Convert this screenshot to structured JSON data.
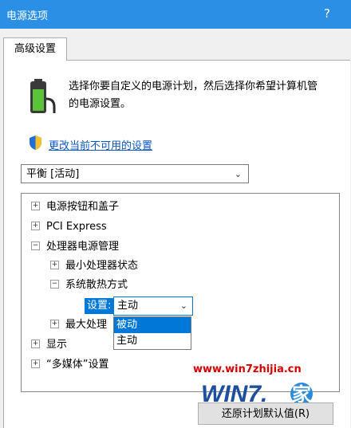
{
  "window": {
    "title": "电源选项",
    "help_label": "?"
  },
  "tab": {
    "label": "高级设置"
  },
  "description": {
    "line1": "选择你要自定义的电源计划，然后选择你希望计算机管",
    "line2": "的电源设置。"
  },
  "link": {
    "label": "更改当前不可用的设置"
  },
  "plan_select": {
    "value": "平衡 [活动]"
  },
  "tree": {
    "items": [
      {
        "label": "电源按钮和盖子",
        "expander": "+"
      },
      {
        "label": "PCI Express",
        "expander": "+"
      },
      {
        "label": "处理器电源管理",
        "expander": "−"
      },
      {
        "label": "最小处理器状态",
        "expander": "+"
      },
      {
        "label": "系统散热方式",
        "expander": "−"
      },
      {
        "label": "最大处理",
        "expander": "+"
      },
      {
        "label": "显示",
        "expander": "+"
      },
      {
        "label": "“多媒体”设置",
        "expander": "+"
      }
    ]
  },
  "setting": {
    "label": "设置:",
    "value": "主动",
    "options": [
      "被动",
      "主动"
    ],
    "highlighted_option": "被动"
  },
  "watermark": {
    "url": "www.win7zhijia.cn",
    "logo_text": "WIN7.",
    "logo_char": "家"
  },
  "restore_button": {
    "label": "还原计划默认值(R)"
  },
  "colors": {
    "title_bar": "#2b8fe6",
    "accent": "#0078d7",
    "link": "#0a56c2",
    "watermark": "#d40000"
  }
}
